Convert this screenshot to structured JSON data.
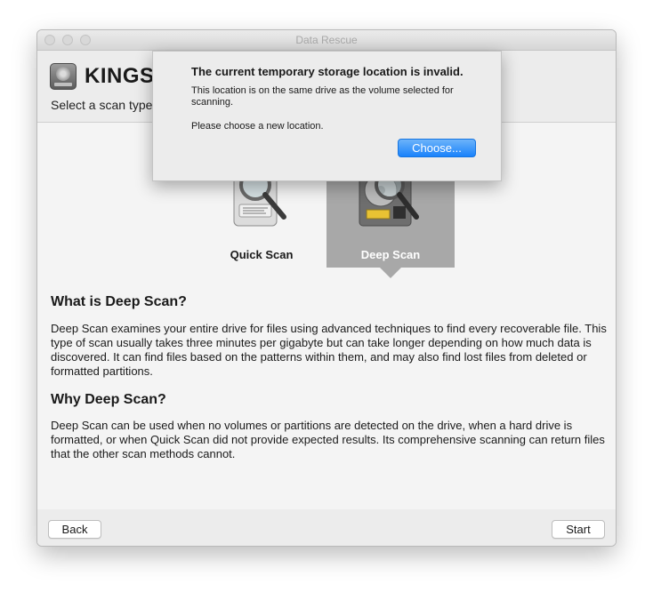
{
  "window": {
    "title": "Data Rescue"
  },
  "header": {
    "drive_name": "KINGST",
    "subtitle": "Select a scan type,"
  },
  "scan_options": [
    {
      "label": "Quick Scan",
      "selected": false,
      "icon": "hdd-magnifier-icon"
    },
    {
      "label": "Deep Scan",
      "selected": true,
      "icon": "hdd-open-magnifier-icon"
    }
  ],
  "description": {
    "what_title": "What is Deep Scan?",
    "what_text": "Deep Scan examines your entire drive for files using advanced techniques to find every recoverable file. This type of scan usually takes three minutes per gigabyte but can take longer depending on how much data is discovered. It can find files based on the patterns within them, and may also find lost files from deleted or formatted partitions.",
    "why_title": "Why Deep Scan?",
    "why_text": "Deep Scan can be used when no volumes or partitions are detected on the drive, when a hard drive is formatted, or when Quick Scan did not provide expected results. Its comprehensive scanning can return files that the other scan methods cannot."
  },
  "footer": {
    "back_label": "Back",
    "start_label": "Start"
  },
  "alert": {
    "title": "The current temporary storage location is invalid.",
    "message": "This location is on the same drive as the volume selected for scanning.",
    "message2": "Please choose a new location.",
    "button_label": "Choose..."
  },
  "colors": {
    "accent": "#1a82fb",
    "selected_bg": "#a8a8a8"
  }
}
